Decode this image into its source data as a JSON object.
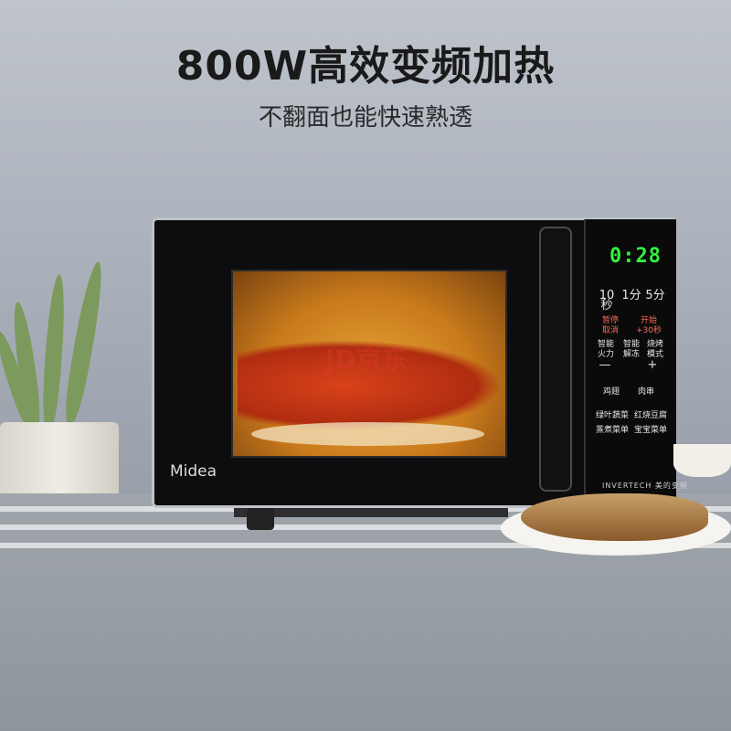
{
  "headline": {
    "title": "800W高效变频加热",
    "subtitle": "不翻面也能快速熟透"
  },
  "product": {
    "brand": "Midea",
    "display_time": "0:28",
    "inverter_badge": "INVERTECH 美的变频",
    "watermark": "JD京东"
  },
  "panel_keys": [
    {
      "label": "10秒"
    },
    {
      "label": "1分"
    },
    {
      "label": "5分"
    },
    {
      "label": "暂停\n取消"
    },
    {
      "label": "开始\n+30秒"
    },
    {
      "label": "智能\n火力"
    },
    {
      "label": "智能\n解冻"
    },
    {
      "label": "烧烤\n模式"
    },
    {
      "label": "—"
    },
    {
      "label": "+"
    },
    {
      "label": "鸡翅"
    },
    {
      "label": "肉串"
    },
    {
      "label": "绿叶蔬菜"
    },
    {
      "label": "红烧豆腐"
    },
    {
      "label": "蒸煮菜单"
    },
    {
      "label": "宝宝菜单"
    }
  ],
  "colors": {
    "display": "#34f03e",
    "accent_red": "#ff6a5a",
    "window_glow": "#e9a43a"
  }
}
